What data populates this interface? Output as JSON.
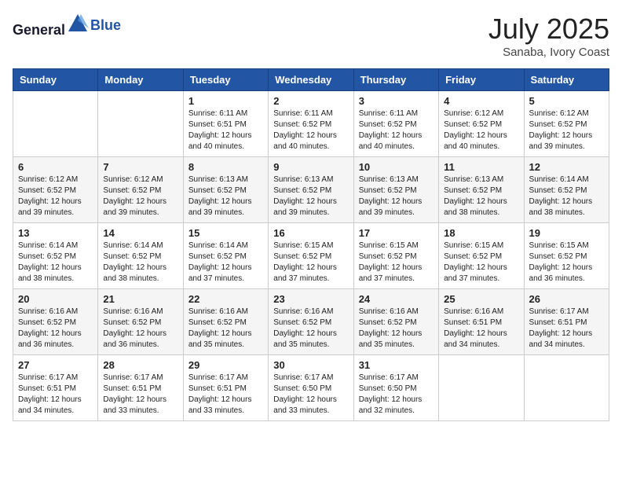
{
  "header": {
    "logo_general": "General",
    "logo_blue": "Blue",
    "month_year": "July 2025",
    "location": "Sanaba, Ivory Coast"
  },
  "weekdays": [
    "Sunday",
    "Monday",
    "Tuesday",
    "Wednesday",
    "Thursday",
    "Friday",
    "Saturday"
  ],
  "weeks": [
    [
      {
        "day": "",
        "sunrise": "",
        "sunset": "",
        "daylight": ""
      },
      {
        "day": "",
        "sunrise": "",
        "sunset": "",
        "daylight": ""
      },
      {
        "day": "1",
        "sunrise": "Sunrise: 6:11 AM",
        "sunset": "Sunset: 6:51 PM",
        "daylight": "Daylight: 12 hours and 40 minutes."
      },
      {
        "day": "2",
        "sunrise": "Sunrise: 6:11 AM",
        "sunset": "Sunset: 6:52 PM",
        "daylight": "Daylight: 12 hours and 40 minutes."
      },
      {
        "day": "3",
        "sunrise": "Sunrise: 6:11 AM",
        "sunset": "Sunset: 6:52 PM",
        "daylight": "Daylight: 12 hours and 40 minutes."
      },
      {
        "day": "4",
        "sunrise": "Sunrise: 6:12 AM",
        "sunset": "Sunset: 6:52 PM",
        "daylight": "Daylight: 12 hours and 40 minutes."
      },
      {
        "day": "5",
        "sunrise": "Sunrise: 6:12 AM",
        "sunset": "Sunset: 6:52 PM",
        "daylight": "Daylight: 12 hours and 39 minutes."
      }
    ],
    [
      {
        "day": "6",
        "sunrise": "Sunrise: 6:12 AM",
        "sunset": "Sunset: 6:52 PM",
        "daylight": "Daylight: 12 hours and 39 minutes."
      },
      {
        "day": "7",
        "sunrise": "Sunrise: 6:12 AM",
        "sunset": "Sunset: 6:52 PM",
        "daylight": "Daylight: 12 hours and 39 minutes."
      },
      {
        "day": "8",
        "sunrise": "Sunrise: 6:13 AM",
        "sunset": "Sunset: 6:52 PM",
        "daylight": "Daylight: 12 hours and 39 minutes."
      },
      {
        "day": "9",
        "sunrise": "Sunrise: 6:13 AM",
        "sunset": "Sunset: 6:52 PM",
        "daylight": "Daylight: 12 hours and 39 minutes."
      },
      {
        "day": "10",
        "sunrise": "Sunrise: 6:13 AM",
        "sunset": "Sunset: 6:52 PM",
        "daylight": "Daylight: 12 hours and 39 minutes."
      },
      {
        "day": "11",
        "sunrise": "Sunrise: 6:13 AM",
        "sunset": "Sunset: 6:52 PM",
        "daylight": "Daylight: 12 hours and 38 minutes."
      },
      {
        "day": "12",
        "sunrise": "Sunrise: 6:14 AM",
        "sunset": "Sunset: 6:52 PM",
        "daylight": "Daylight: 12 hours and 38 minutes."
      }
    ],
    [
      {
        "day": "13",
        "sunrise": "Sunrise: 6:14 AM",
        "sunset": "Sunset: 6:52 PM",
        "daylight": "Daylight: 12 hours and 38 minutes."
      },
      {
        "day": "14",
        "sunrise": "Sunrise: 6:14 AM",
        "sunset": "Sunset: 6:52 PM",
        "daylight": "Daylight: 12 hours and 38 minutes."
      },
      {
        "day": "15",
        "sunrise": "Sunrise: 6:14 AM",
        "sunset": "Sunset: 6:52 PM",
        "daylight": "Daylight: 12 hours and 37 minutes."
      },
      {
        "day": "16",
        "sunrise": "Sunrise: 6:15 AM",
        "sunset": "Sunset: 6:52 PM",
        "daylight": "Daylight: 12 hours and 37 minutes."
      },
      {
        "day": "17",
        "sunrise": "Sunrise: 6:15 AM",
        "sunset": "Sunset: 6:52 PM",
        "daylight": "Daylight: 12 hours and 37 minutes."
      },
      {
        "day": "18",
        "sunrise": "Sunrise: 6:15 AM",
        "sunset": "Sunset: 6:52 PM",
        "daylight": "Daylight: 12 hours and 37 minutes."
      },
      {
        "day": "19",
        "sunrise": "Sunrise: 6:15 AM",
        "sunset": "Sunset: 6:52 PM",
        "daylight": "Daylight: 12 hours and 36 minutes."
      }
    ],
    [
      {
        "day": "20",
        "sunrise": "Sunrise: 6:16 AM",
        "sunset": "Sunset: 6:52 PM",
        "daylight": "Daylight: 12 hours and 36 minutes."
      },
      {
        "day": "21",
        "sunrise": "Sunrise: 6:16 AM",
        "sunset": "Sunset: 6:52 PM",
        "daylight": "Daylight: 12 hours and 36 minutes."
      },
      {
        "day": "22",
        "sunrise": "Sunrise: 6:16 AM",
        "sunset": "Sunset: 6:52 PM",
        "daylight": "Daylight: 12 hours and 35 minutes."
      },
      {
        "day": "23",
        "sunrise": "Sunrise: 6:16 AM",
        "sunset": "Sunset: 6:52 PM",
        "daylight": "Daylight: 12 hours and 35 minutes."
      },
      {
        "day": "24",
        "sunrise": "Sunrise: 6:16 AM",
        "sunset": "Sunset: 6:52 PM",
        "daylight": "Daylight: 12 hours and 35 minutes."
      },
      {
        "day": "25",
        "sunrise": "Sunrise: 6:16 AM",
        "sunset": "Sunset: 6:51 PM",
        "daylight": "Daylight: 12 hours and 34 minutes."
      },
      {
        "day": "26",
        "sunrise": "Sunrise: 6:17 AM",
        "sunset": "Sunset: 6:51 PM",
        "daylight": "Daylight: 12 hours and 34 minutes."
      }
    ],
    [
      {
        "day": "27",
        "sunrise": "Sunrise: 6:17 AM",
        "sunset": "Sunset: 6:51 PM",
        "daylight": "Daylight: 12 hours and 34 minutes."
      },
      {
        "day": "28",
        "sunrise": "Sunrise: 6:17 AM",
        "sunset": "Sunset: 6:51 PM",
        "daylight": "Daylight: 12 hours and 33 minutes."
      },
      {
        "day": "29",
        "sunrise": "Sunrise: 6:17 AM",
        "sunset": "Sunset: 6:51 PM",
        "daylight": "Daylight: 12 hours and 33 minutes."
      },
      {
        "day": "30",
        "sunrise": "Sunrise: 6:17 AM",
        "sunset": "Sunset: 6:50 PM",
        "daylight": "Daylight: 12 hours and 33 minutes."
      },
      {
        "day": "31",
        "sunrise": "Sunrise: 6:17 AM",
        "sunset": "Sunset: 6:50 PM",
        "daylight": "Daylight: 12 hours and 32 minutes."
      },
      {
        "day": "",
        "sunrise": "",
        "sunset": "",
        "daylight": ""
      },
      {
        "day": "",
        "sunrise": "",
        "sunset": "",
        "daylight": ""
      }
    ]
  ]
}
